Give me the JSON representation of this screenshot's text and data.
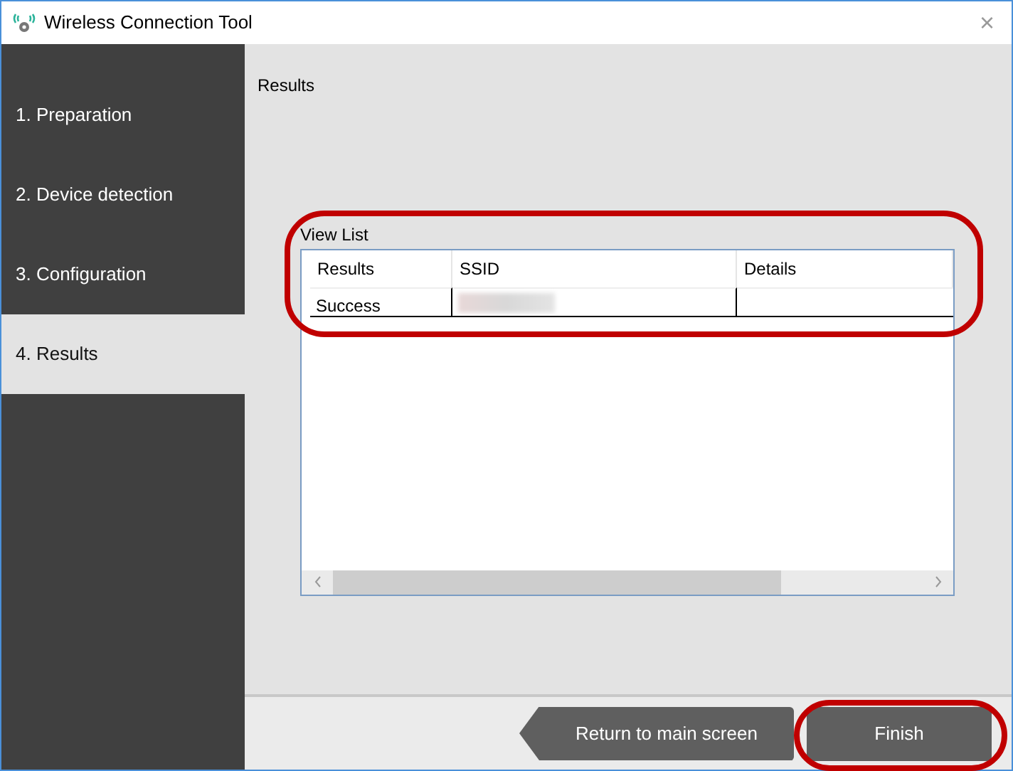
{
  "window": {
    "title": "Wireless Connection Tool",
    "close": "×"
  },
  "steps": [
    {
      "label": "1. Preparation",
      "selected": false
    },
    {
      "label": "2. Device detection",
      "selected": false
    },
    {
      "label": "3. Configuration",
      "selected": false
    },
    {
      "label": "4. Results",
      "selected": true
    }
  ],
  "page_title": "Results",
  "view_list": {
    "label": "View List",
    "highlighted": true,
    "columns": [
      "Results",
      "SSID",
      "Details"
    ],
    "rows": [
      {
        "results": "Success",
        "ssid_redacted": true,
        "details": ""
      }
    ]
  },
  "buttons": [
    {
      "kind": "back",
      "label": "Return to main screen",
      "highlighted": false
    },
    {
      "kind": "primary",
      "label": "Finish",
      "highlighted": true
    }
  ]
}
